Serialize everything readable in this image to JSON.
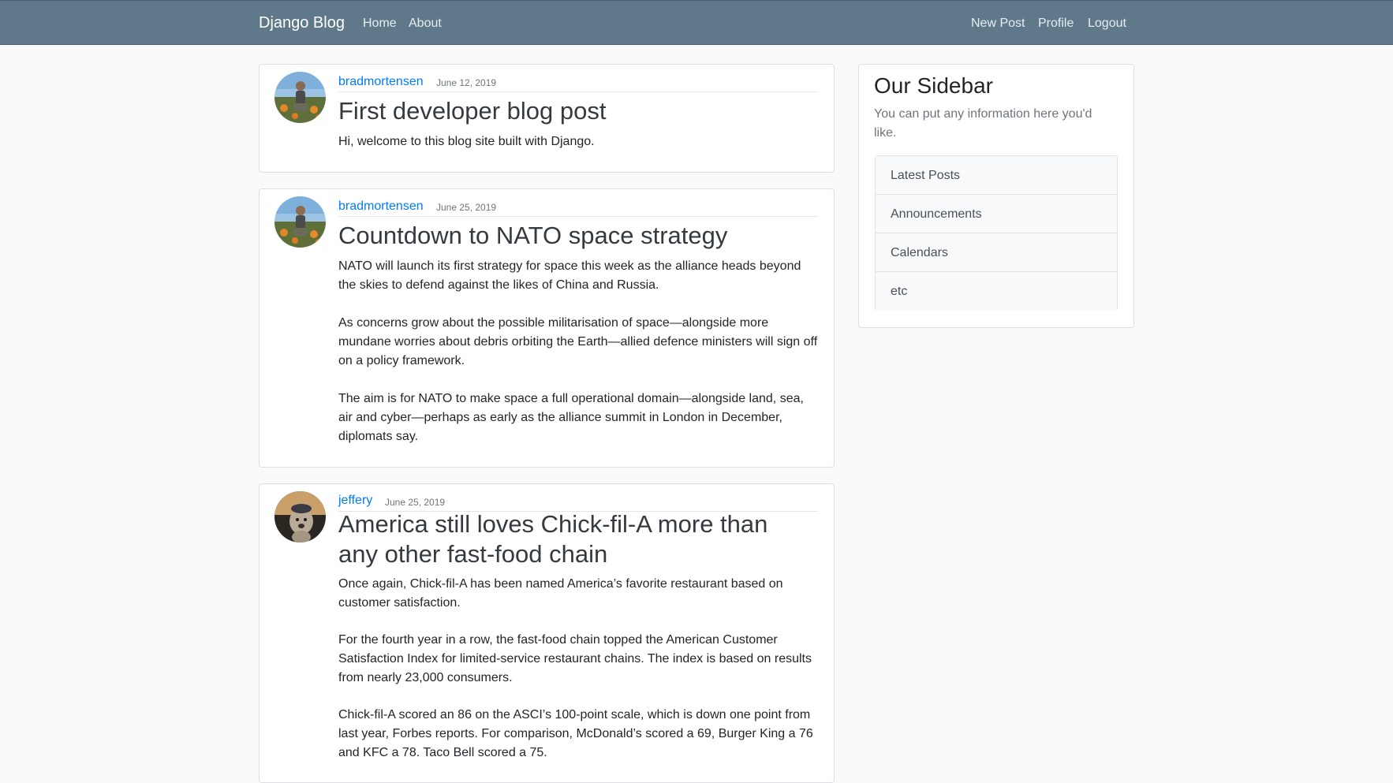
{
  "navbar": {
    "brand": "Django Blog",
    "left_links": [
      "Home",
      "About"
    ],
    "right_links": [
      "New Post",
      "Profile",
      "Logout"
    ]
  },
  "posts": [
    {
      "author": "bradmortensen",
      "date": "June 12, 2019",
      "title": "First developer blog post",
      "paragraphs": [
        "Hi, welcome to this blog site built with Django."
      ]
    },
    {
      "author": "bradmortensen",
      "date": "June 25, 2019",
      "title": "Countdown to NATO space strategy",
      "paragraphs": [
        "NATO will launch its first strategy for space this week as the alliance heads beyond the skies to defend against the likes of China and Russia.",
        "As concerns grow about the possible militarisation of space—alongside more mundane worries about debris orbiting the Earth—allied defence ministers will sign off on a policy framework.",
        "The aim is for NATO to make space a full operational domain—alongside land, sea, air and cyber—perhaps as early as the alliance summit in London in December, diplomats say."
      ]
    },
    {
      "author": "jeffery",
      "date": "June 25, 2019",
      "title": "America still loves Chick-fil-A more than any other fast-food chain",
      "paragraphs": [
        "Once again, Chick-fil-A has been named America’s favorite restaurant based on customer satisfaction.",
        "For the fourth year in a row, the fast-food chain topped the American Customer Satisfaction Index for limited-service restaurant chains. The index is based on results from nearly 23,000 consumers.",
        "Chick-fil-A scored an 86 on the ASCI’s 100-point scale, which is down one point from last year, Forbes reports. For comparison, McDonald’s scored a 69, Burger King a 76 and KFC a 78. Taco Bell scored a 75."
      ]
    }
  ],
  "sidebar": {
    "title": "Our Sidebar",
    "text": "You can put any information here you'd like.",
    "items": [
      "Latest Posts",
      "Announcements",
      "Calendars",
      "etc"
    ]
  },
  "colors": {
    "navbar_bg": "#5f788a",
    "link": "#007bff"
  },
  "icons": {
    "avatar_1": "user-avatar-icon",
    "avatar_2": "user-avatar-icon",
    "avatar_3": "user-avatar-icon"
  }
}
